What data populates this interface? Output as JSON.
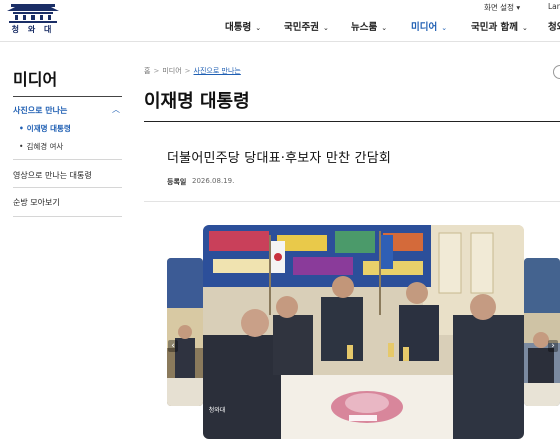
{
  "header": {
    "logo_text": "청 와 대",
    "utility": {
      "settings": "화면 설정 ▾",
      "language": "Lan"
    },
    "nav": [
      {
        "label": "대통령",
        "active": false
      },
      {
        "label": "국민주권",
        "active": false
      },
      {
        "label": "뉴스룸",
        "active": false
      },
      {
        "label": "미디어",
        "active": true
      },
      {
        "label": "국민과 함께",
        "active": false
      },
      {
        "label": "청와",
        "active": false
      }
    ],
    "nav_chevron": "⌄"
  },
  "sidebar": {
    "title": "미디어",
    "menu": [
      {
        "label": "사진으로 만나는",
        "expanded": true,
        "toggle": "︿",
        "children": [
          {
            "label": "이재명 대통령",
            "active": true
          },
          {
            "label": "김혜경 여사",
            "active": false
          }
        ]
      },
      {
        "label": "영상으로 만나는 대통령",
        "expanded": false
      },
      {
        "label": "순방 모아보기",
        "expanded": false
      }
    ],
    "bullet": "•"
  },
  "breadcrumb": {
    "home": "홈",
    "items": [
      "미디어",
      "사진으로 만나는"
    ],
    "separator": ">"
  },
  "page": {
    "title": "이재명 대통령"
  },
  "article": {
    "title": "더불어민주당 당대표·후보자 만찬 간담회",
    "reg_label": "등록일",
    "reg_date": "2026.08.19."
  },
  "gallery": {
    "prev_arrow": "‹",
    "next_arrow": "›",
    "watermark_text": "청와대"
  },
  "colors": {
    "accent": "#1f5fb3",
    "brand_navy": "#1a2e66",
    "divider": "#222222"
  }
}
